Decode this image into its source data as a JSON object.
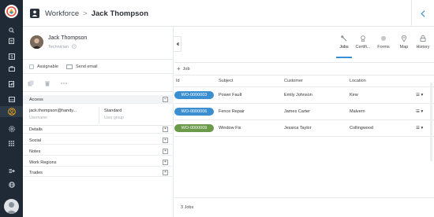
{
  "header": {
    "app_name": "Workforce",
    "separator": ">",
    "title": "Jack Thompson"
  },
  "profile": {
    "name": "Jack Thompson",
    "role": "Technician"
  },
  "flags": {
    "assignable": "Assignable",
    "send_email": "Send email"
  },
  "access": {
    "label": "Access",
    "toggle": "−",
    "email": "jack.thompson@handy...",
    "email_sub": "Username",
    "group": "Standard",
    "group_sub": "User group"
  },
  "sections": [
    {
      "label": "Details",
      "toggle": "+"
    },
    {
      "label": "Social",
      "toggle": "+"
    },
    {
      "label": "Notes",
      "toggle": "+"
    },
    {
      "label": "Work Regions",
      "toggle": "+"
    },
    {
      "label": "Trades",
      "toggle": "+"
    }
  ],
  "tabs": [
    {
      "label": "Jobs",
      "icon": "wrench-icon"
    },
    {
      "label": "Certifi...",
      "icon": "certificate-icon"
    },
    {
      "label": "Forms",
      "icon": "forms-icon"
    },
    {
      "label": "Map",
      "icon": "map-pin-icon"
    },
    {
      "label": "History",
      "icon": "history-icon"
    }
  ],
  "toolbar": {
    "add_label": "Job"
  },
  "table": {
    "columns": [
      "Id",
      "Subject",
      "Customer",
      "Location"
    ],
    "rows": [
      {
        "id": "WO-0000003",
        "subject": "Power Fault",
        "customer": "Emily Johnson",
        "location": "Kew",
        "color": "#3b8fd0"
      },
      {
        "id": "WO-0000006",
        "subject": "Fence Repair",
        "customer": "James Carter",
        "location": "Malvern",
        "color": "#3b8fd0"
      },
      {
        "id": "WO-0000009",
        "subject": "Window Fix",
        "customer": "Jessica Taylor",
        "location": "Collingwood",
        "color": "#6a9a4a"
      }
    ]
  },
  "footer": {
    "count": "3 Jobs"
  },
  "colors": {
    "accent": "#3a8fd4",
    "rail": "#1f2a36"
  }
}
